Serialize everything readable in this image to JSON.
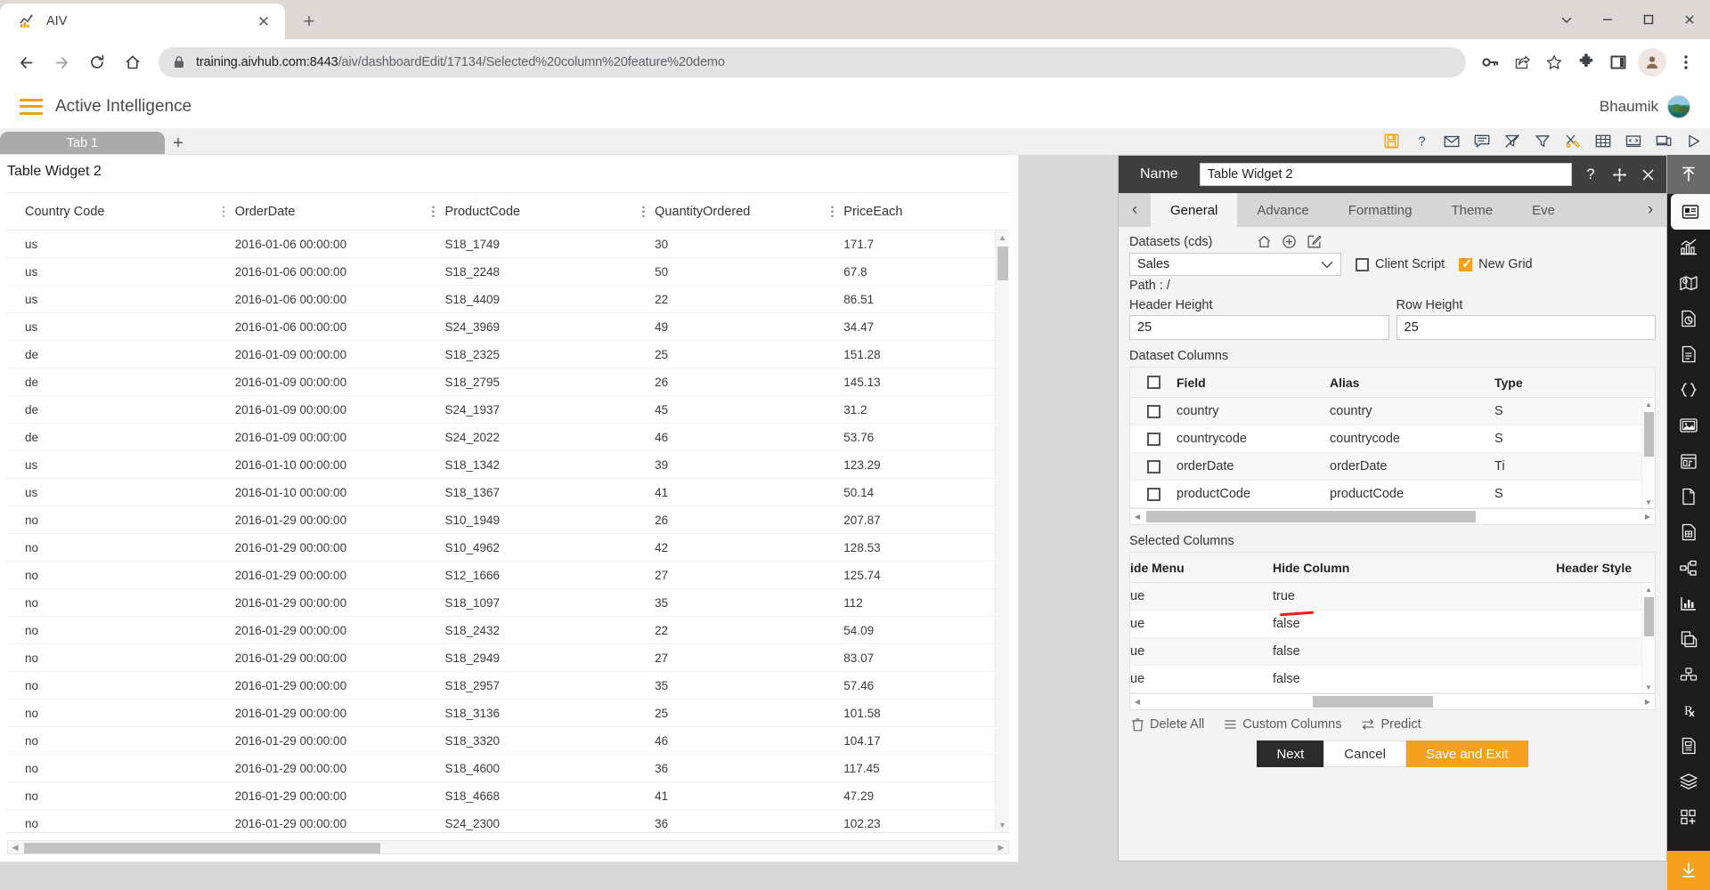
{
  "browser": {
    "tab": {
      "title": "AIV",
      "favicon": "chart-favicon-icon"
    },
    "newtab_label": "+",
    "close_label": "✕",
    "url_main": "training.aivhub.com:8443",
    "url_path": "/aiv/dashboardEdit/17134/Selected%20column%20feature%20demo",
    "nav": {
      "back": "←",
      "forward": "→",
      "reload": "⟳",
      "home": "⌂"
    },
    "toolbar_icons": [
      "key-icon",
      "share-icon",
      "star-icon",
      "extensions-puzzle-icon",
      "side-panel-icon",
      "profile-avatar-icon",
      "chrome-menu-icon"
    ],
    "window_controls": [
      "minimize-v-icon",
      "minimize-icon",
      "maximize-icon",
      "close-icon"
    ]
  },
  "app": {
    "title": "Active Intelligence",
    "menu_icon": "hamburger-menu-icon",
    "user": "Bhaumik",
    "avatar": "user-avatar-photo"
  },
  "tabbar": {
    "tabs": [
      {
        "label": "Tab 1"
      }
    ],
    "add_label": "+",
    "toolbar": [
      {
        "name": "save-icon",
        "glyph": "save"
      },
      {
        "name": "help-icon",
        "glyph": "?"
      },
      {
        "name": "mail-icon",
        "glyph": "mail"
      },
      {
        "name": "comment-icon",
        "glyph": "comment"
      },
      {
        "name": "filter-off-icon",
        "glyph": "filter-off"
      },
      {
        "name": "filter-icon",
        "glyph": "filter"
      },
      {
        "name": "tools-icon",
        "glyph": "tools"
      },
      {
        "name": "table-icon",
        "glyph": "table"
      },
      {
        "name": "code-icon",
        "glyph": "code"
      },
      {
        "name": "devices-icon",
        "glyph": "devices"
      },
      {
        "name": "play-icon",
        "glyph": "play"
      }
    ]
  },
  "widget": {
    "title": "Table Widget 2",
    "columns": [
      "Country Code",
      "OrderDate",
      "ProductCode",
      "QuantityOrdered",
      "PriceEach"
    ],
    "rows": [
      [
        "us",
        "2016-01-06 00:00:00",
        "S18_1749",
        "30",
        "171.7"
      ],
      [
        "us",
        "2016-01-06 00:00:00",
        "S18_2248",
        "50",
        "67.8"
      ],
      [
        "us",
        "2016-01-06 00:00:00",
        "S18_4409",
        "22",
        "86.51"
      ],
      [
        "us",
        "2016-01-06 00:00:00",
        "S24_3969",
        "49",
        "34.47"
      ],
      [
        "de",
        "2016-01-09 00:00:00",
        "S18_2325",
        "25",
        "151.28"
      ],
      [
        "de",
        "2016-01-09 00:00:00",
        "S18_2795",
        "26",
        "145.13"
      ],
      [
        "de",
        "2016-01-09 00:00:00",
        "S24_1937",
        "45",
        "31.2"
      ],
      [
        "de",
        "2016-01-09 00:00:00",
        "S24_2022",
        "46",
        "53.76"
      ],
      [
        "us",
        "2016-01-10 00:00:00",
        "S18_1342",
        "39",
        "123.29"
      ],
      [
        "us",
        "2016-01-10 00:00:00",
        "S18_1367",
        "41",
        "50.14"
      ],
      [
        "no",
        "2016-01-29 00:00:00",
        "S10_1949",
        "26",
        "207.87"
      ],
      [
        "no",
        "2016-01-29 00:00:00",
        "S10_4962",
        "42",
        "128.53"
      ],
      [
        "no",
        "2016-01-29 00:00:00",
        "S12_1666",
        "27",
        "125.74"
      ],
      [
        "no",
        "2016-01-29 00:00:00",
        "S18_1097",
        "35",
        "112"
      ],
      [
        "no",
        "2016-01-29 00:00:00",
        "S18_2432",
        "22",
        "54.09"
      ],
      [
        "no",
        "2016-01-29 00:00:00",
        "S18_2949",
        "27",
        "83.07"
      ],
      [
        "no",
        "2016-01-29 00:00:00",
        "S18_2957",
        "35",
        "57.46"
      ],
      [
        "no",
        "2016-01-29 00:00:00",
        "S18_3136",
        "25",
        "101.58"
      ],
      [
        "no",
        "2016-01-29 00:00:00",
        "S18_3320",
        "46",
        "104.17"
      ],
      [
        "no",
        "2016-01-29 00:00:00",
        "S18_4600",
        "36",
        "117.45"
      ],
      [
        "no",
        "2016-01-29 00:00:00",
        "S18_4668",
        "41",
        "47.29"
      ],
      [
        "no",
        "2016-01-29 00:00:00",
        "S24_2300",
        "36",
        "102.23"
      ]
    ]
  },
  "panel": {
    "name_label": "Name",
    "name_value": "Table Widget 2",
    "title_icons": [
      "help-icon",
      "move-icon",
      "close-icon"
    ],
    "tabs": [
      {
        "label": "General",
        "active": true
      },
      {
        "label": "Advance",
        "active": false
      },
      {
        "label": "Formatting",
        "active": false
      },
      {
        "label": "Theme",
        "active": false
      },
      {
        "label": "Eve",
        "active": false
      }
    ],
    "datasets_label": "Datasets (cds)",
    "datasets_icons": [
      "home-icon",
      "add-circle-icon",
      "edit-icon"
    ],
    "dataset_value": "Sales",
    "path_label": "Path : /",
    "client_script_label": "Client Script",
    "client_script_checked": false,
    "new_grid_label": "New Grid",
    "new_grid_checked": true,
    "header_height_label": "Header Height",
    "header_height_value": "25",
    "row_height_label": "Row Height",
    "row_height_value": "25",
    "dataset_columns_label": "Dataset Columns",
    "dataset_columns_headers": [
      "Field",
      "Alias",
      "Type"
    ],
    "dataset_columns_rows": [
      {
        "field": "country",
        "alias": "country",
        "type": "S"
      },
      {
        "field": "countrycode",
        "alias": "countrycode",
        "type": "S"
      },
      {
        "field": "orderDate",
        "alias": "orderDate",
        "type": "Ti"
      },
      {
        "field": "productCode",
        "alias": "productCode",
        "type": "S"
      }
    ],
    "selected_columns_label": "Selected Columns",
    "selected_columns_headers": [
      "ide Menu",
      "Hide Column",
      "Header Style"
    ],
    "selected_columns_rows": [
      {
        "menu": "ue",
        "hide": "true"
      },
      {
        "menu": "ue",
        "hide": "false"
      },
      {
        "menu": "ue",
        "hide": "false"
      },
      {
        "menu": "ue",
        "hide": "false"
      }
    ],
    "actions": [
      {
        "label": "Delete All",
        "icon": "trash-icon"
      },
      {
        "label": "Custom Columns",
        "icon": "list-icon"
      },
      {
        "label": "Predict",
        "icon": "swap-icon"
      }
    ],
    "buttons": {
      "next": "Next",
      "cancel": "Cancel",
      "save_exit": "Save and Exit"
    }
  },
  "rail": {
    "top_icon": "collapse-up-icon",
    "selected_icon": "widget-card-icon",
    "icons": [
      "bar-chart-icon",
      "map-icon",
      "pie-report-icon",
      "document-icon",
      "json-braces-icon",
      "image-icon",
      "calendar-media-icon",
      "file-icon",
      "data-file-icon",
      "tree-icon",
      "sparkline-icon",
      "copy-page-icon",
      "cubes-icon",
      "rx-icon",
      "report-icon",
      "layers-icon",
      "grid-add-icon"
    ],
    "bottom_icon": "download-icon"
  },
  "colors": {
    "accent_orange": "#f5a11d",
    "panel_title_bg": "#3f3f3f",
    "rail_bg": "#1c1c1c",
    "annotation_red": "#e0211b"
  }
}
